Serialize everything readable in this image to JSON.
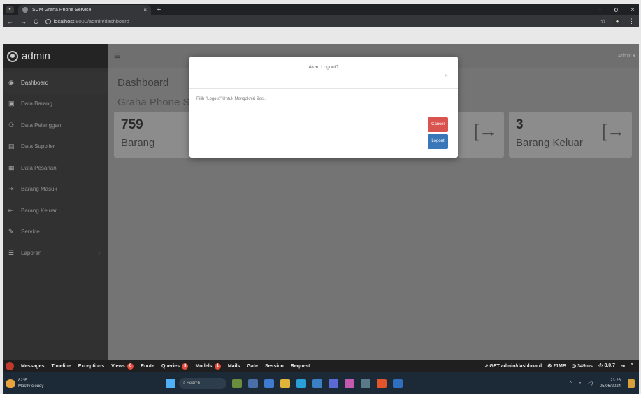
{
  "browser": {
    "tab_title": "SCM Graha Phone Service",
    "tab_close": "×",
    "new_tab": "+",
    "url_host": "localhost",
    "url_path": ":8000/admin/dashboard",
    "window_min": "–",
    "window_max": "o",
    "window_close": "×"
  },
  "sidebar": {
    "user": "admin",
    "items": [
      {
        "label": "Dashboard",
        "icon": "dashboard-icon",
        "glyph": "◉",
        "active": true
      },
      {
        "label": "Data Barang",
        "icon": "box-icon",
        "glyph": "▣"
      },
      {
        "label": "Data Pelanggan",
        "icon": "users-icon",
        "glyph": "⚇"
      },
      {
        "label": "Data Supplier",
        "icon": "supplier-icon",
        "glyph": "▤"
      },
      {
        "label": "Data Pesanan",
        "icon": "order-icon",
        "glyph": "▦"
      },
      {
        "label": "Barang Masuk",
        "icon": "sign-in-icon",
        "glyph": "⇥"
      },
      {
        "label": "Barang Keluar",
        "icon": "sign-out-icon",
        "glyph": "⇤"
      },
      {
        "label": "Service",
        "icon": "wrench-icon",
        "glyph": "✎",
        "caret": "‹"
      },
      {
        "label": "Laporan",
        "icon": "report-icon",
        "glyph": "☰",
        "caret": "‹"
      }
    ]
  },
  "topbar": {
    "menu_glyph": "≡",
    "user_menu": "Admin ▾"
  },
  "page": {
    "title": "Dashboard",
    "subtitle": "Graha Phone S"
  },
  "cards": [
    {
      "value": "759",
      "label": "Barang"
    },
    {
      "value": "3",
      "label": "Barang Keluar",
      "arrow": "[→"
    }
  ],
  "card_mid_arrow": "[→",
  "modal": {
    "title": "Akan Logout?",
    "close": "×",
    "body": "Pilih \"Logout\" Untuk Mengakhiri Sesi.",
    "cancel": "Cancel",
    "logout": "Logout"
  },
  "debugbar": {
    "items": [
      {
        "label": "Messages"
      },
      {
        "label": "Timeline"
      },
      {
        "label": "Exceptions"
      },
      {
        "label": "Views",
        "badge": "6"
      },
      {
        "label": "Route"
      },
      {
        "label": "Queries",
        "badge": "3"
      },
      {
        "label": "Models",
        "badge": "1"
      },
      {
        "label": "Mails"
      },
      {
        "label": "Gate"
      },
      {
        "label": "Session"
      },
      {
        "label": "Request"
      }
    ],
    "request": "GET admin/dashboard",
    "memory": "21MB",
    "time": "349ms",
    "php": "8.0.7"
  },
  "taskbar": {
    "temp": "82°F",
    "weather": "Mostly cloudy",
    "search": "Search",
    "time": "23:26",
    "date": "05/06/2024"
  },
  "colors": {
    "cancel": "#d9534f",
    "logout": "#3a77b8",
    "debug_badge": "#e74c3c"
  }
}
